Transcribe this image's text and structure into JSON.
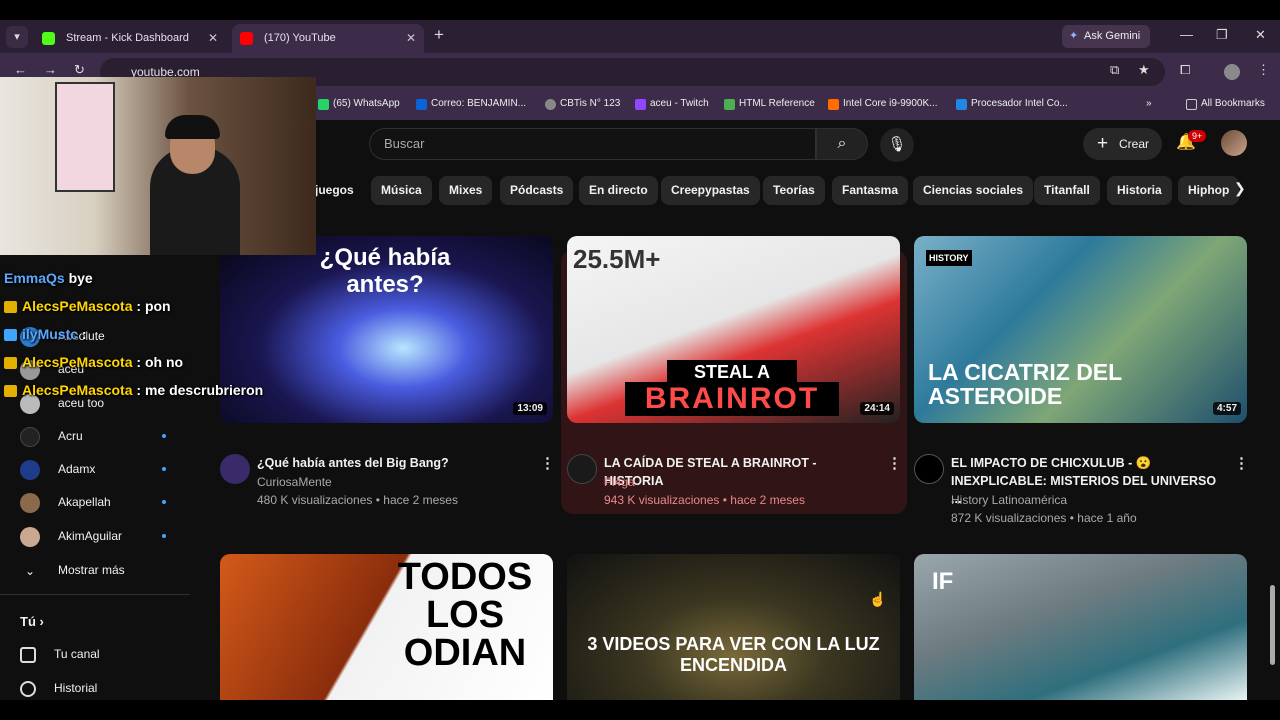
{
  "browser": {
    "tabs": [
      {
        "title": "Stream - Kick Dashboard",
        "color": "#53fc18"
      },
      {
        "title": "(170) YouTube",
        "color": "#ff0000"
      }
    ],
    "new_tab": "+",
    "gemini": "Ask Gemini",
    "url": "youtube.com",
    "bookmarks": [
      {
        "label": "(65) WhatsApp",
        "color": "#25d366"
      },
      {
        "label": "Correo: BENJAMIN...",
        "color": "#0a64d8"
      },
      {
        "label": "CBTis N° 123",
        "color": "#888888"
      },
      {
        "label": "aceu - Twitch",
        "color": "#9146ff"
      },
      {
        "label": "HTML Reference",
        "color": "#4caf50"
      },
      {
        "label": "Intel Core i9-9900K...",
        "color": "#ff6d00"
      },
      {
        "label": "Procesador Intel Co...",
        "color": "#1e88e5"
      }
    ],
    "all_bookmarks": "All Bookmarks"
  },
  "youtube": {
    "search_placeholder": "Buscar",
    "create_label": "Crear",
    "notif_count": "9+",
    "chips": [
      "juegos",
      "Música",
      "Mixes",
      "Pódcasts",
      "En directo",
      "Creepypastas",
      "Teorías",
      "Fantasma",
      "Ciencias sociales",
      "Titanfall",
      "Historia",
      "Hiphop"
    ],
    "videos": [
      {
        "title": "¿Qué había antes del Big Bang?",
        "channel": "CuriosaMente",
        "meta": "480 K visualizaciones • hace 2 meses",
        "duration": "13:09",
        "thumb_text": "¿Qué había antes?"
      },
      {
        "title": "LA CAÍDA DE STEAL A BRAINROT - HISTORIA",
        "channel": "Pl4ga",
        "meta": "943 K visualizaciones • hace 2 meses",
        "duration": "24:14",
        "thumb_text_top": "25.5M+",
        "thumb_text_a": "STEAL A",
        "thumb_text_b": "BRAINROT"
      },
      {
        "title": "EL IMPACTO DE CHICXULUB - 😮 INEXPLICABLE: MISTERIOS DEL UNIVERSO ...",
        "channel": "History Latinoamérica",
        "meta": "872 K visualizaciones • hace 1 año",
        "duration": "4:57",
        "thumb_text": "LA CICATRIZ DEL ASTEROIDE",
        "thumb_logo": "HISTORY"
      },
      {
        "thumb_text": "TODOS LOS ODIAN"
      },
      {
        "thumb_text": "3 VIDEOS PARA VER CON LA LUZ ENCENDIDA"
      },
      {
        "thumb_text": "IF"
      }
    ]
  },
  "sidebar": {
    "subs": [
      {
        "name": "Absolute"
      },
      {
        "name": "aceu"
      },
      {
        "name": "aceu too"
      },
      {
        "name": "Acru"
      },
      {
        "name": "Adamx"
      },
      {
        "name": "Akapellah"
      },
      {
        "name": "AkimAguilar"
      }
    ],
    "show_more": "Mostrar más",
    "you_header": "Tú",
    "you_items": [
      "Tu canal",
      "Historial"
    ]
  },
  "chat": [
    {
      "name": "EmmaQs",
      "msg": "bye"
    },
    {
      "name": "AlecsPeMascota",
      "msg": ": pon"
    },
    {
      "name": "ilyMustc",
      "msg": ":"
    },
    {
      "name": "AlecsPeMascota",
      "msg": ": oh no"
    },
    {
      "name": "AlecsPeMascota",
      "msg": ": me descrubrieron"
    }
  ]
}
